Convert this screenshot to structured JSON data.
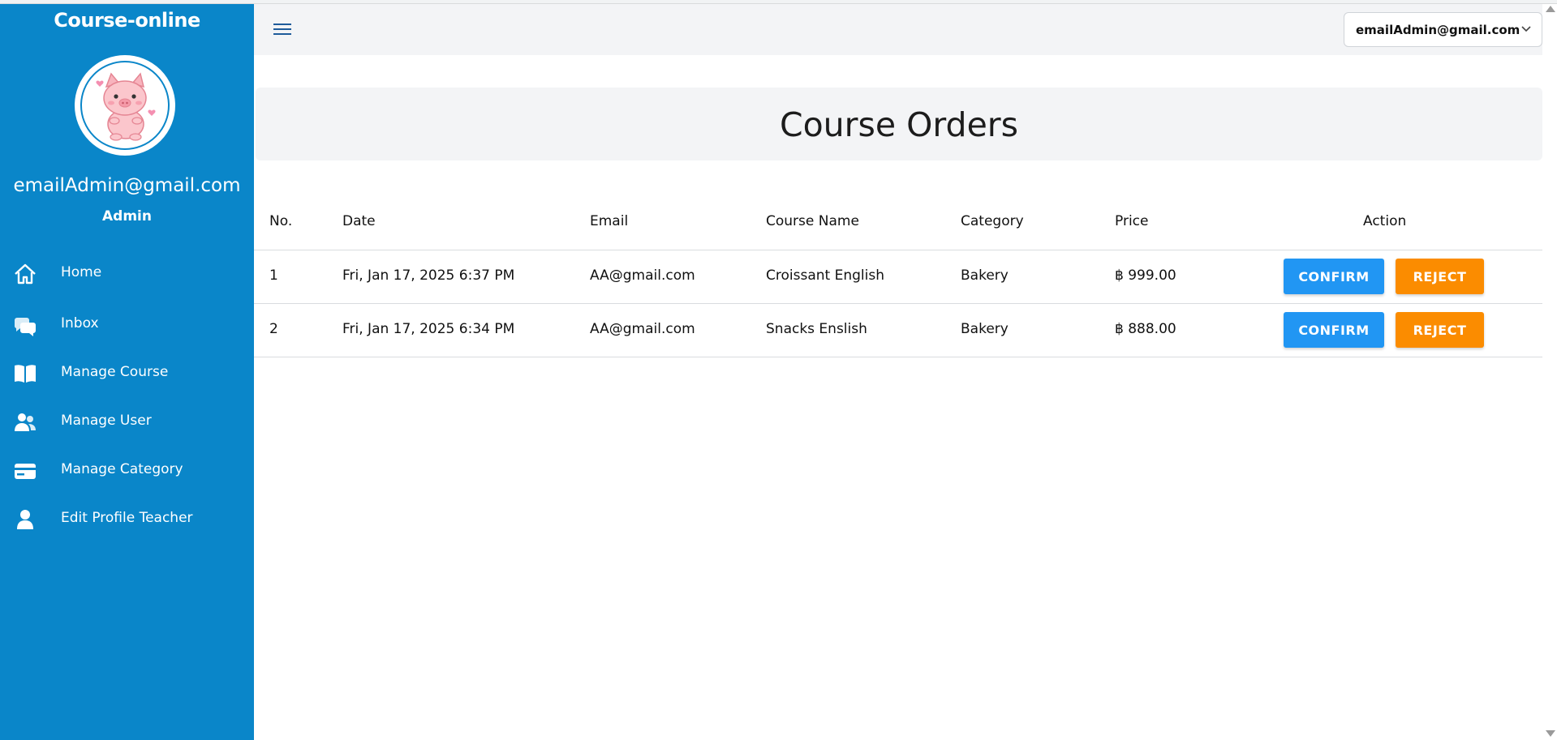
{
  "sidebar": {
    "brand": "Course-online",
    "user_email": "emailAdmin@gmail.com",
    "user_role": "Admin",
    "items": [
      {
        "label": "Home",
        "icon": "home-icon"
      },
      {
        "label": "Inbox",
        "icon": "chat-icon"
      },
      {
        "label": "Manage Course",
        "icon": "book-icon"
      },
      {
        "label": "Manage User",
        "icon": "users-icon"
      },
      {
        "label": "Manage Category",
        "icon": "card-icon"
      },
      {
        "label": "Edit Profile Teacher",
        "icon": "person-icon"
      }
    ]
  },
  "header": {
    "menu_icon": "hamburger-icon",
    "account_select_value": "emailAdmin@gmail.com"
  },
  "page": {
    "title": "Course Orders"
  },
  "table": {
    "columns": [
      "No.",
      "Date",
      "Email",
      "Course Name",
      "Category",
      "Price",
      "Action"
    ],
    "rows": [
      {
        "no": "1",
        "date": "Fri, Jan 17, 2025 6:37 PM",
        "email": "AA@gmail.com",
        "course": "Croissant English",
        "category": "Bakery",
        "price": "฿ 999.00"
      },
      {
        "no": "2",
        "date": "Fri, Jan 17, 2025 6:34 PM",
        "email": "AA@gmail.com",
        "course": "Snacks Enslish",
        "category": "Bakery",
        "price": "฿ 888.00"
      }
    ],
    "confirm_label": "CONFIRM",
    "reject_label": "REJECT"
  },
  "colors": {
    "sidebar": "#0a86c9",
    "confirm": "#2196f3",
    "reject": "#fb8c00",
    "panel": "#f3f4f6"
  }
}
